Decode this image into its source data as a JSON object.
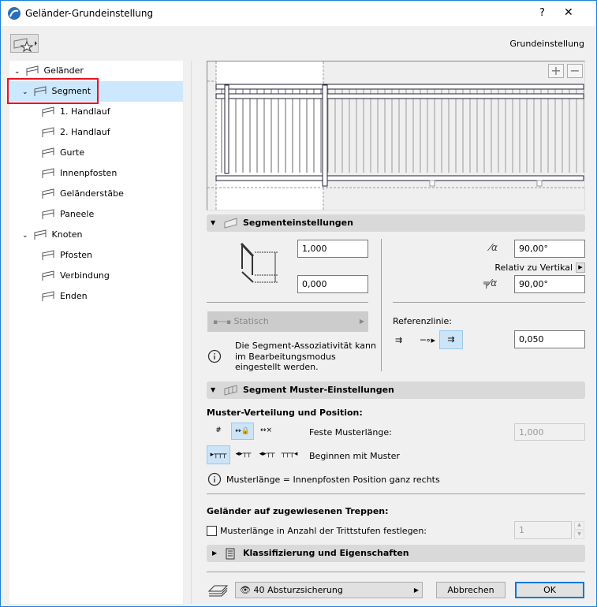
{
  "window": {
    "title": "Geländer-Grundeinstellung",
    "help": "?",
    "close": "✕",
    "subtitle": "Grundeinstellung"
  },
  "tree": [
    {
      "label": "Geländer",
      "icon": "railing-icon"
    },
    {
      "label": "Segment",
      "icon": "segment-icon"
    },
    {
      "label": "1. Handlauf",
      "icon": "handrail-icon"
    },
    {
      "label": "2. Handlauf",
      "icon": "handrail2-icon"
    },
    {
      "label": "Gurte",
      "icon": "rails-icon"
    },
    {
      "label": "Innenpfosten",
      "icon": "inner-post-icon"
    },
    {
      "label": "Geländerstäbe",
      "icon": "balusters-icon"
    },
    {
      "label": "Paneele",
      "icon": "panel-icon"
    },
    {
      "label": "Knoten",
      "icon": "node-icon"
    },
    {
      "label": "Pfosten",
      "icon": "post-icon"
    },
    {
      "label": "Verbindung",
      "icon": "connection-icon"
    },
    {
      "label": "Enden",
      "icon": "ends-icon"
    }
  ],
  "preview": {
    "zoom_in": "+",
    "zoom_out": "−"
  },
  "segment": {
    "header": "Segmenteinstellungen",
    "height": "1,000",
    "offset": "0,000",
    "angle1": "90,00°",
    "relative": "Relativ zu Vertikal",
    "angle2": "90,00°",
    "static": "Statisch",
    "info": [
      "Die Segment-Assoziativität kann",
      "im Bearbeitungsmodus",
      "eingestellt werden."
    ],
    "ref_label": "Referenzlinie:",
    "ref_value": "0,050"
  },
  "pattern": {
    "header": "Segment Muster-Einstellungen",
    "dist_label": "Muster-Verteilung und Position:",
    "fixed_label": "Feste Musterlänge:",
    "fixed_value": "1,000",
    "begin_label": "Beginnen mit Muster",
    "info": "Musterlänge = Innenpfosten Position ganz rechts",
    "stairs_label": "Geländer auf zugewiesenen Treppen:",
    "checkbox_label": "Musterlänge in Anzahl der Trittstufen festlegen:",
    "steps_value": "1"
  },
  "classification": {
    "header": "Klassifizierung und Eigenschaften"
  },
  "footer": {
    "layer": "40 Absturzsicherung",
    "cancel": "Abbrechen",
    "ok": "OK"
  }
}
